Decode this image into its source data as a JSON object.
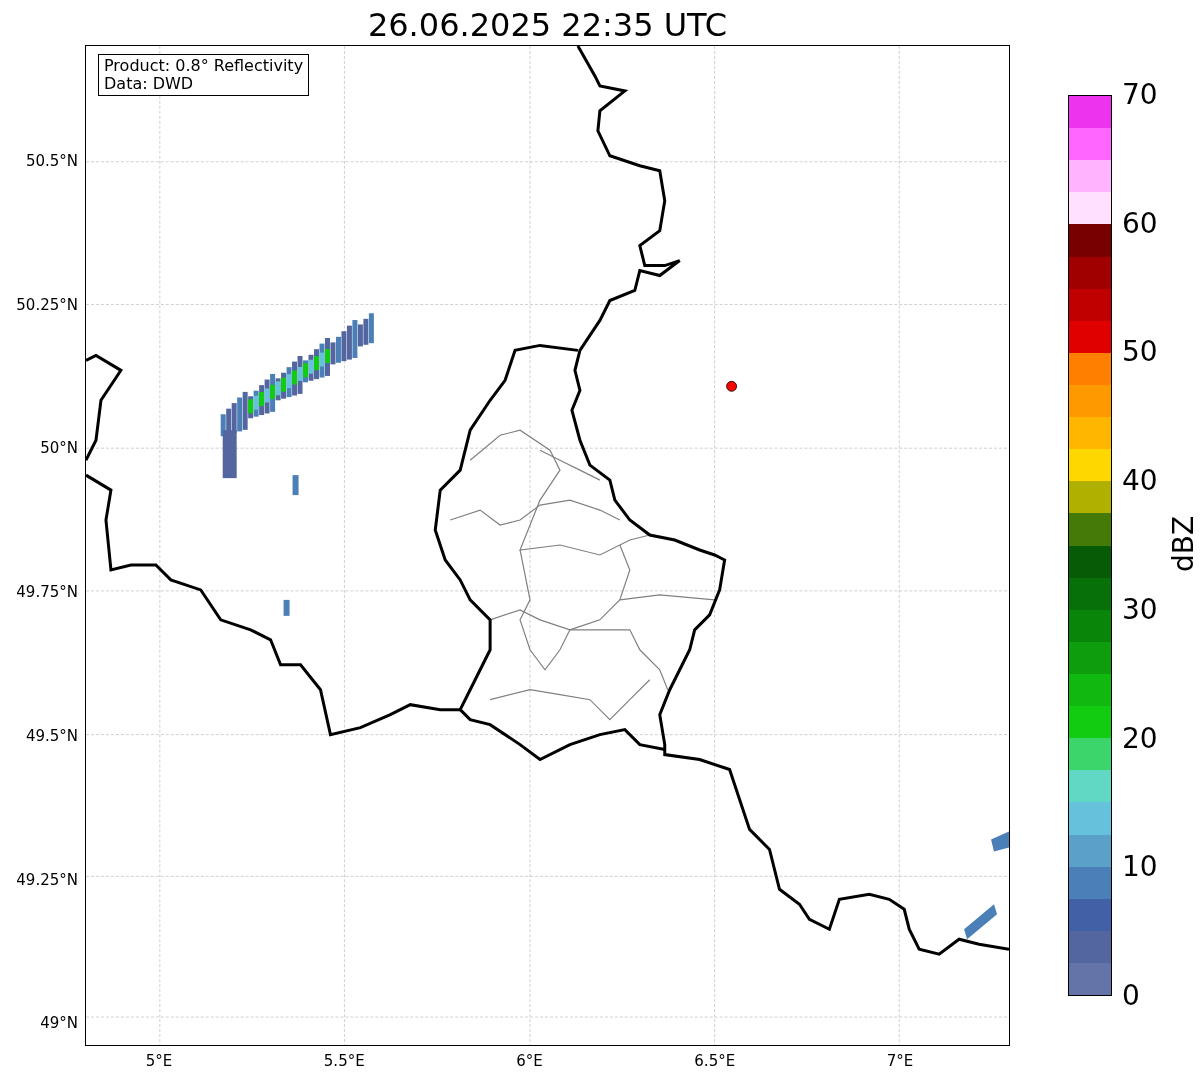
{
  "title": "26.06.2025 22:35 UTC",
  "map": {
    "legend": [
      "Product: 0.8° Reflectivity",
      "Data: DWD"
    ]
  },
  "y_ticks": [
    "50.5°N",
    "50.25°N",
    "50°N",
    "49.75°N",
    "49.5°N",
    "49.25°N",
    "49°N"
  ],
  "x_ticks": [
    "5°E",
    "5.5°E",
    "6°E",
    "6.5°E",
    "7°E"
  ],
  "colorbar": {
    "label": "dBZ",
    "ticks": [
      "70",
      "60",
      "50",
      "40",
      "30",
      "20",
      "10",
      "0"
    ],
    "bins": [
      {
        "color": "#ee33ee"
      },
      {
        "color": "#ff66ff"
      },
      {
        "color": "#ffb3ff"
      },
      {
        "color": "#ffe0ff"
      },
      {
        "color": "#780000"
      },
      {
        "color": "#a00000"
      },
      {
        "color": "#c00000"
      },
      {
        "color": "#e00000"
      },
      {
        "color": "#ff7f00"
      },
      {
        "color": "#ff9900"
      },
      {
        "color": "#ffb600"
      },
      {
        "color": "#ffd700"
      },
      {
        "color": "#afb000"
      },
      {
        "color": "#467a08"
      },
      {
        "color": "#075b07"
      },
      {
        "color": "#087008"
      },
      {
        "color": "#098509"
      },
      {
        "color": "#0d9d0d"
      },
      {
        "color": "#10b810"
      },
      {
        "color": "#12cc12"
      },
      {
        "color": "#3bd56b"
      },
      {
        "color": "#60d8c4"
      },
      {
        "color": "#66c2dc"
      },
      {
        "color": "#5aa0c8"
      },
      {
        "color": "#4b7fb8"
      },
      {
        "color": "#4260a6"
      },
      {
        "color": "#5366a0"
      },
      {
        "color": "#6474a8"
      }
    ]
  }
}
